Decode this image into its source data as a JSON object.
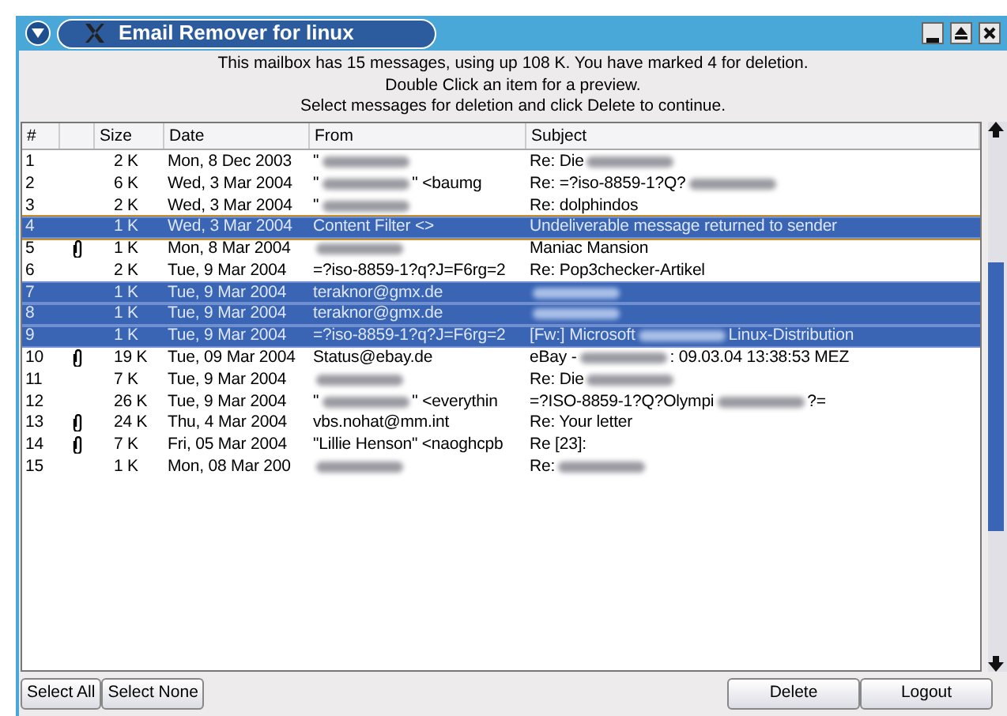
{
  "window": {
    "title": "Email Remover for linux"
  },
  "info_lines": [
    "This mailbox has 15 messages, using up 108 K. You have marked 4 for deletion.",
    "Double Click an item for a preview.",
    "Select messages for deletion and click Delete to continue."
  ],
  "table": {
    "columns": [
      "#",
      "",
      "Size",
      "Date",
      "From",
      "Subject"
    ],
    "rows": [
      {
        "num": "1",
        "attachment": false,
        "size": "2 K",
        "date": "Mon, 8 Dec 2003",
        "from": "\"",
        "from_redacted": true,
        "subject": "Re: Die",
        "subject_redacted": true,
        "selected": false,
        "focused": false
      },
      {
        "num": "2",
        "attachment": false,
        "size": "6 K",
        "date": "Wed, 3 Mar 2004",
        "from": "\"",
        "from_redacted": true,
        "from_tail": "\" <baumg",
        "subject": "Re:  =?iso-8859-1?Q?",
        "subject_redacted": true,
        "selected": false,
        "focused": false
      },
      {
        "num": "3",
        "attachment": false,
        "size": "2 K",
        "date": "Wed, 3 Mar 2004",
        "from": "\"",
        "from_redacted": true,
        "subject": "Re: dolphindos",
        "subject_redacted": false,
        "selected": false,
        "focused": false
      },
      {
        "num": "4",
        "attachment": false,
        "size": "1 K",
        "date": "Wed,  3 Mar 2004",
        "from": "Content Filter <>",
        "from_redacted": false,
        "subject": "Undeliverable message returned to sender",
        "subject_redacted": false,
        "selected": true,
        "focused": true
      },
      {
        "num": "5",
        "attachment": true,
        "size": "1 K",
        "date": "Mon, 8 Mar 2004",
        "from": "",
        "from_redacted": true,
        "subject": "Maniac Mansion",
        "subject_redacted": false,
        "selected": false,
        "focused": false
      },
      {
        "num": "6",
        "attachment": false,
        "size": "2 K",
        "date": "Tue, 9 Mar 2004",
        "from": "=?iso-8859-1?q?J=F6rg=2",
        "from_redacted": false,
        "subject": "Re: Pop3checker-Artikel",
        "subject_redacted": false,
        "selected": false,
        "focused": false
      },
      {
        "num": "7",
        "attachment": false,
        "size": "1 K",
        "date": "Tue, 9 Mar 2004",
        "from": "teraknor@gmx.de",
        "from_redacted": false,
        "subject": "",
        "subject_redacted": true,
        "selected": true,
        "focused": false
      },
      {
        "num": "8",
        "attachment": false,
        "size": "1 K",
        "date": "Tue, 9 Mar 2004",
        "from": "teraknor@gmx.de",
        "from_redacted": false,
        "subject": "",
        "subject_redacted": true,
        "selected": true,
        "focused": false
      },
      {
        "num": "9",
        "attachment": false,
        "size": "1 K",
        "date": "Tue, 9 Mar 2004",
        "from": "=?iso-8859-1?q?J=F6rg=2",
        "from_redacted": false,
        "subject": "[Fw:] Microsoft",
        "subject_redacted": true,
        "subject_tail": "Linux-Distribution",
        "selected": true,
        "focused": false
      },
      {
        "num": "10",
        "attachment": true,
        "size": "19 K",
        "date": "Tue, 09 Mar 2004",
        "from": "Status@ebay.de",
        "from_redacted": false,
        "subject": "eBay -",
        "subject_redacted": true,
        "subject_tail": ": 09.03.04 13:38:53 MEZ",
        "selected": false,
        "focused": false
      },
      {
        "num": "11",
        "attachment": false,
        "size": "7 K",
        "date": "Tue, 9 Mar 2004",
        "from": "",
        "from_redacted": true,
        "subject": "Re: Die",
        "subject_redacted": true,
        "selected": false,
        "focused": false
      },
      {
        "num": "12",
        "attachment": false,
        "size": "26 K",
        "date": "Tue, 9 Mar 2004",
        "from": "\"",
        "from_redacted": true,
        "from_tail": "\" <everythin",
        "subject": "=?ISO-8859-1?Q?Olympi",
        "subject_redacted": true,
        "subject_tail": "?=",
        "selected": false,
        "focused": false
      },
      {
        "num": "13",
        "attachment": true,
        "size": "24 K",
        "date": "Thu, 4 Mar 2004",
        "from": "vbs.nohat@mm.int",
        "from_redacted": false,
        "subject": "Re: Your letter",
        "subject_redacted": false,
        "selected": false,
        "focused": false
      },
      {
        "num": "14",
        "attachment": true,
        "size": "7 K",
        "date": "Fri, 05 Mar 2004",
        "from": "\"Lillie Henson\" <naoghcpb",
        "from_redacted": false,
        "subject": "Re [23]:",
        "subject_redacted": false,
        "selected": false,
        "focused": false
      },
      {
        "num": "15",
        "attachment": false,
        "size": "1 K",
        "date": "Mon, 08 Mar 200",
        "from": "",
        "from_redacted": true,
        "subject": "Re:",
        "subject_redacted": true,
        "selected": false,
        "focused": false
      }
    ]
  },
  "buttons_left": [
    "Select All",
    "Select None"
  ],
  "buttons_right": [
    "Delete",
    "Logout"
  ]
}
